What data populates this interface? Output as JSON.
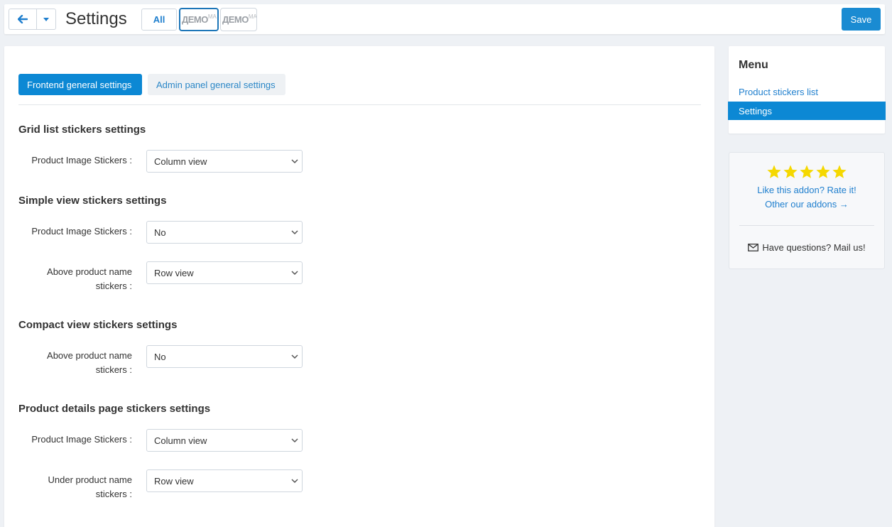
{
  "header": {
    "title": "Settings",
    "all_label": "All",
    "demo1_main": "ДЕМО",
    "demo1_sup": "MA",
    "demo2_main": "ДЕМО",
    "demo2_sup": "MA",
    "save_label": "Save"
  },
  "tabs": [
    {
      "label": "Frontend general settings",
      "active": true
    },
    {
      "label": "Admin panel general settings",
      "active": false
    }
  ],
  "sections": {
    "grid": {
      "title": "Grid list stickers settings",
      "fields": [
        {
          "label": "Product Image Stickers :",
          "value": "Column view"
        }
      ]
    },
    "simple": {
      "title": "Simple view stickers settings",
      "fields": [
        {
          "label": "Product Image Stickers :",
          "value": "No"
        },
        {
          "label_line1": "Above product name",
          "label_line2": "stickers :",
          "value": "Row view"
        }
      ]
    },
    "compact": {
      "title": "Compact view stickers settings",
      "fields": [
        {
          "label_line1": "Above product name",
          "label_line2": "stickers :",
          "value": "No"
        }
      ]
    },
    "details": {
      "title": "Product details page stickers settings",
      "fields": [
        {
          "label": "Product Image Stickers :",
          "value": "Column view"
        },
        {
          "label_line1": "Under product name",
          "label_line2": "stickers :",
          "value": "Row view"
        }
      ]
    }
  },
  "sidebar": {
    "menu_title": "Menu",
    "items": [
      {
        "label": "Product stickers list",
        "active": false
      },
      {
        "label": "Settings",
        "active": true
      }
    ],
    "rating": {
      "stars": 5,
      "star_color": "#f5d800",
      "rate_text": "Like this addon? Rate it!",
      "other_text": "Other our addons →",
      "mail_text": "Have questions? Mail us!"
    }
  },
  "colors": {
    "accent": "#0c88d4",
    "link": "#1f7fce",
    "background": "#eef1f5"
  }
}
